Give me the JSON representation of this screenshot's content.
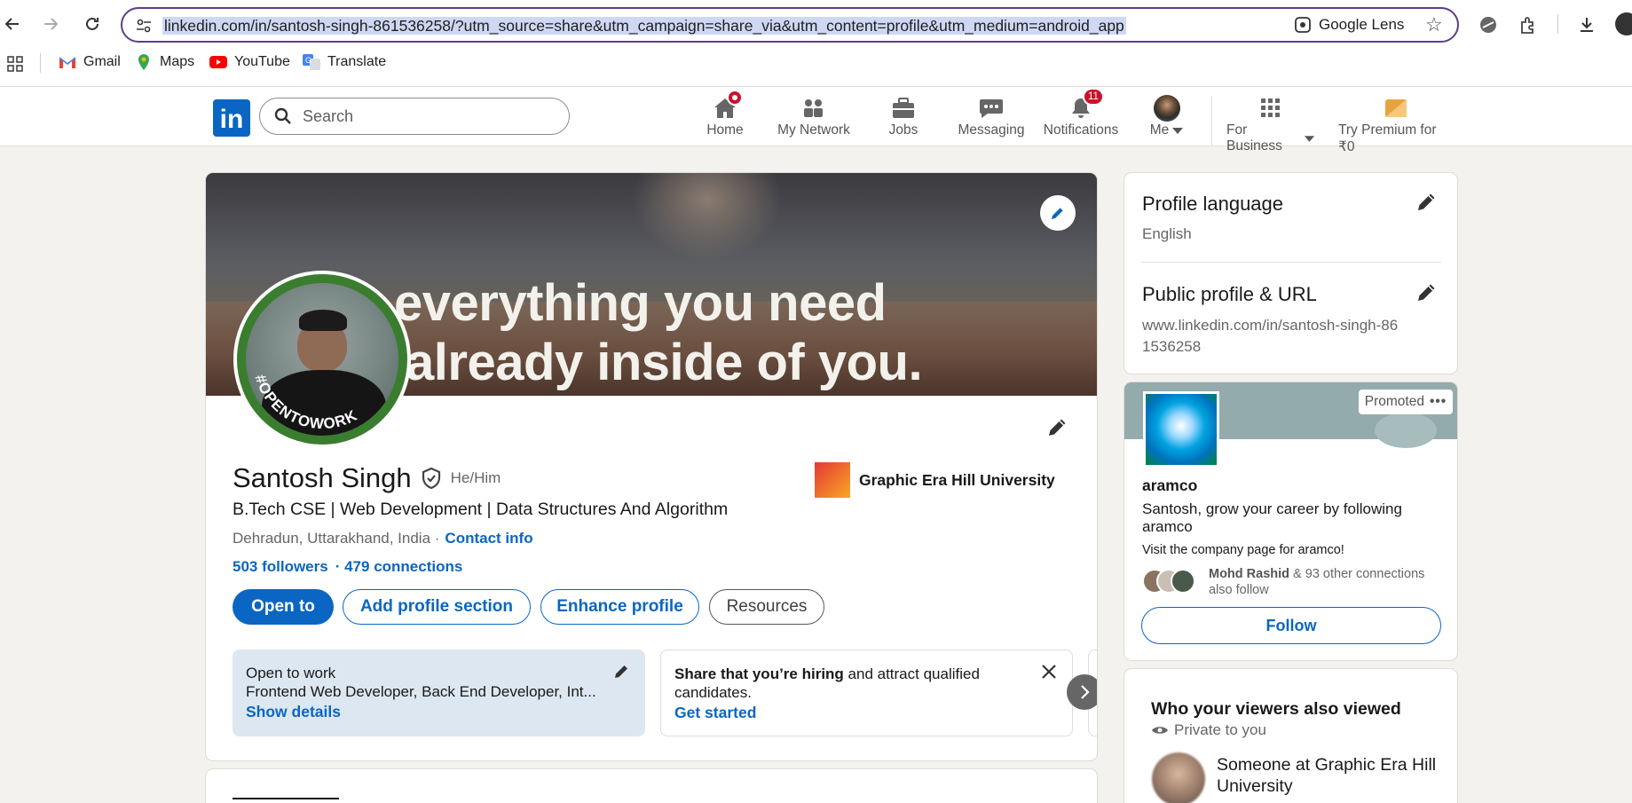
{
  "browser": {
    "url": "linkedin.com/in/santosh-singh-861536258/?utm_source=share&utm_campaign=share_via&utm_content=profile&utm_medium=android_app",
    "lens_label": "Google Lens",
    "bookmarks": [
      {
        "label": "Gmail",
        "icon": "gmail-icon"
      },
      {
        "label": "Maps",
        "icon": "maps-icon"
      },
      {
        "label": "YouTube",
        "icon": "youtube-icon"
      },
      {
        "label": "Translate",
        "icon": "translate-icon"
      }
    ]
  },
  "linkedin_nav": {
    "search_placeholder": "Search",
    "items": [
      {
        "label": "Home",
        "icon": "home-icon",
        "badge": ""
      },
      {
        "label": "My Network",
        "icon": "network-icon",
        "badge": ""
      },
      {
        "label": "Jobs",
        "icon": "briefcase-icon",
        "badge": ""
      },
      {
        "label": "Messaging",
        "icon": "message-icon",
        "badge": ""
      },
      {
        "label": "Notifications",
        "icon": "bell-icon",
        "badge": "11"
      },
      {
        "label": "Me",
        "icon": "avatar-icon",
        "badge": ""
      },
      {
        "label": "For Business",
        "icon": "grid-icon",
        "badge": ""
      },
      {
        "label": "Try Premium for ₹0",
        "icon": "premium-icon",
        "badge": ""
      }
    ]
  },
  "profile": {
    "banner_line1": "everything you need",
    "banner_line2": "already inside of you.",
    "avatar_ring_text": "#OPENTOWORK",
    "name": "Santosh Singh",
    "pronouns": "He/Him",
    "headline": "B.Tech CSE | Web Development | Data Structures And Algorithm",
    "location": "Dehradun, Uttarakhand, India ·",
    "contact_info": "Contact info",
    "followers": "503 followers",
    "connections": "· 479 connections",
    "education": "Graphic Era Hill University",
    "buttons": {
      "open_to": "Open to",
      "add_section": "Add profile section",
      "enhance": "Enhance profile",
      "resources": "Resources"
    },
    "open_to_work": {
      "title": "Open to work",
      "roles": "Frontend Web Developer, Back End Developer, Int...",
      "show_details": "Show details"
    },
    "hiring": {
      "bold": "Share that you’re hiring",
      "rest": " and attract qualified candidates.",
      "cta": "Get started"
    }
  },
  "sidebar": {
    "profile_language": {
      "title": "Profile language",
      "value": "English"
    },
    "public_profile": {
      "title": "Public profile & URL",
      "value": "www.linkedin.com/in/santosh-singh-861536258"
    },
    "ad": {
      "promoted": "Promoted",
      "company": "aramco",
      "message": "Santosh, grow your career by following aramco",
      "visit": "Visit the company page for aramco!",
      "connection_name": "Mohd Rashid",
      "connection_rest": " & 93 other connections also follow",
      "follow": "Follow"
    },
    "viewers": {
      "title": "Who your viewers also viewed",
      "private": "Private to you",
      "person": "Someone at Graphic Era Hill University"
    }
  },
  "colors": {
    "brand": "#0a66c2",
    "badge": "#cb112d",
    "opentowork": "#3a7d2f"
  }
}
